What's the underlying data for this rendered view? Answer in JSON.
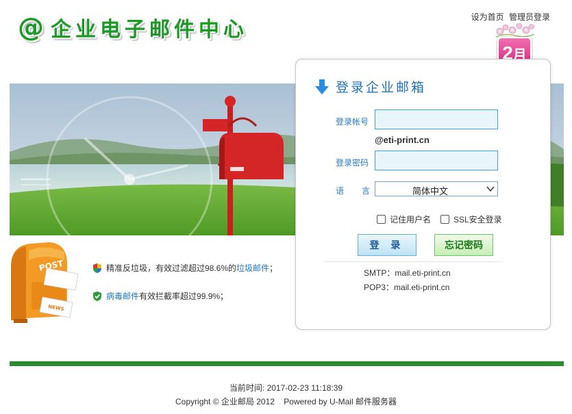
{
  "header": {
    "logo_at": "@",
    "logo_text": "企业电子邮件中心",
    "links": [
      "设为首页",
      "管理员登录"
    ]
  },
  "month_badge": {
    "number": "2",
    "unit": "月"
  },
  "login": {
    "title": "登录企业邮箱",
    "account_label": "登录帐号",
    "account_value": "",
    "domain": "@eti-print.cn",
    "password_label": "登录密码",
    "password_value": "",
    "language_label_1": "语",
    "language_label_2": "言",
    "language_selected": "简体中文",
    "remember_label": "记住用户名",
    "ssl_label": "SSL安全登录",
    "login_button": "登 录",
    "forgot_button": "忘记密码",
    "smtp_label": "SMTP：",
    "smtp_value": "mail.eti-print.cn",
    "pop3_label": "POP3：",
    "pop3_value": "mail.eti-print.cn"
  },
  "features": [
    {
      "text_before": "精准反垃圾，有效过滤超过98.6%的",
      "link": "垃圾邮件",
      "text_after": "；"
    },
    {
      "text_before": "",
      "link": "病毒邮件",
      "text_after": "有效拦截率超过99.9%；"
    }
  ],
  "footer": {
    "current_time_label": "当前时间:",
    "current_time_value": "2017-02-23 11:18:39",
    "copyright": "Copyright © 企业邮局 2012",
    "powered": "Powered by U-Mail 邮件服务器"
  },
  "colors": {
    "brand_green": "#1b9a25",
    "link_blue": "#1d77c0",
    "label_blue": "#2b7bbf",
    "footer_bar": "#2b8b2e",
    "badge_pink": "#d51f7d"
  },
  "icons": [
    "arrow-down-icon",
    "shield-icon",
    "shield-check-icon",
    "chevron-down-icon",
    "mailbox-illustration"
  ]
}
